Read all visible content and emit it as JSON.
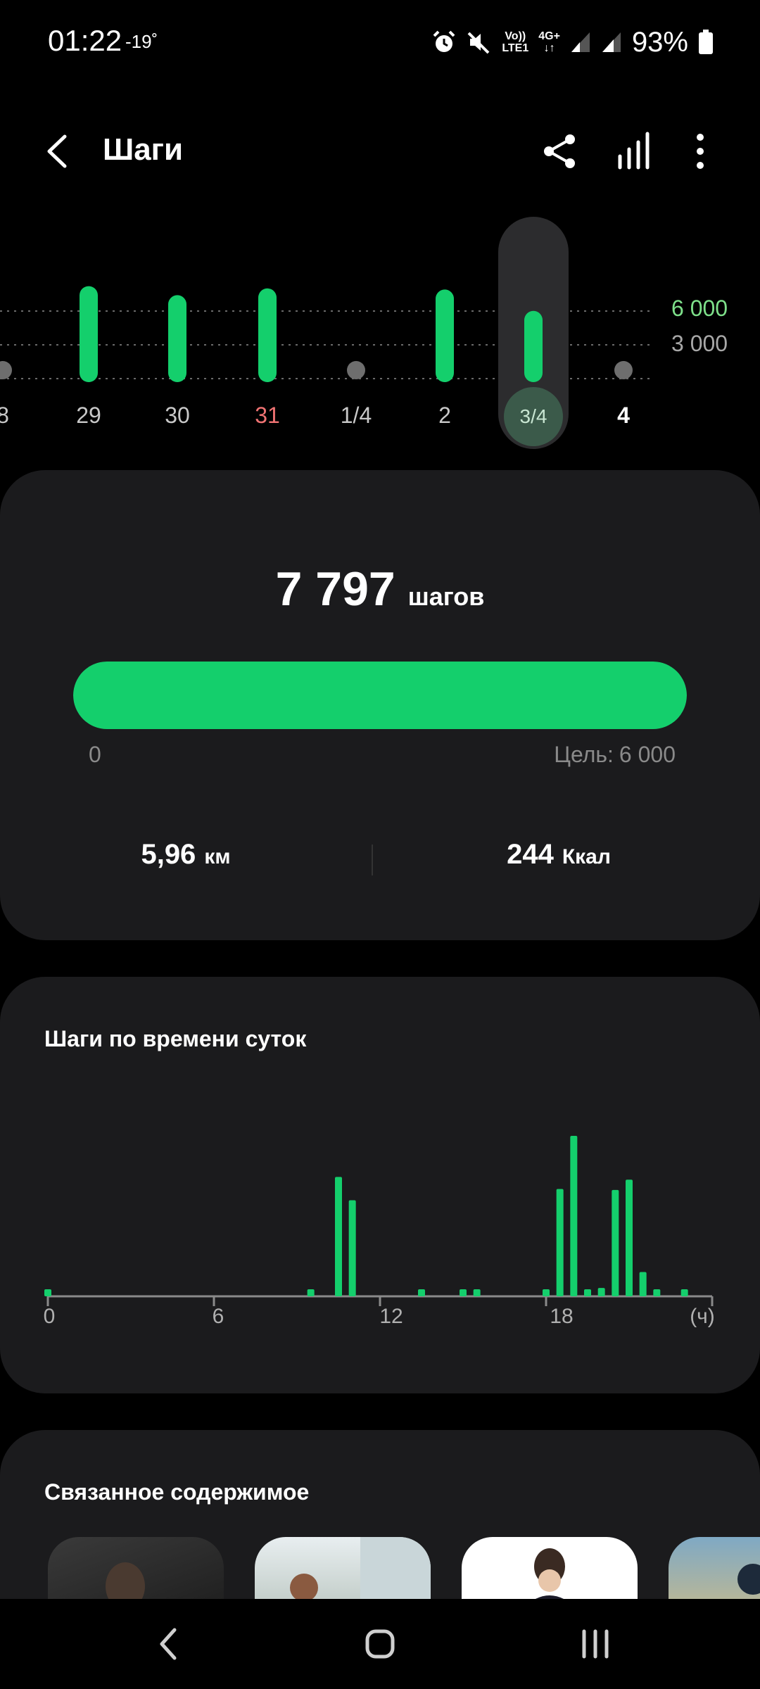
{
  "status_bar": {
    "time": "01:22",
    "temperature": "-19˚",
    "volte_line1": "Vo))",
    "volte_line2": "LTE1",
    "network_line1": "4G+",
    "network_line2": "↓↑",
    "battery": "93%",
    "icons": [
      "alarm-icon",
      "mute-icon",
      "signal-icon",
      "signal-icon",
      "battery-icon"
    ]
  },
  "header": {
    "title": "Шаги",
    "icons": [
      "back-arrow-icon",
      "share-icon",
      "bar-chart-icon",
      "more-vertical-icon"
    ]
  },
  "day_chart": {
    "type": "bar",
    "categories": [
      "8",
      "29",
      "30",
      "31",
      "1/4",
      "2",
      "3/4",
      "4"
    ],
    "values": [
      0,
      7400,
      6600,
      7200,
      0,
      7100,
      5200,
      0
    ],
    "reference_lines": [
      6000,
      3000
    ],
    "reference_labels": [
      "6 000",
      "3 000"
    ],
    "selected_category": "3/4",
    "holiday_category": "31",
    "today_category": "4",
    "colors": {
      "bar": "#14cf6c",
      "empty": "#6e6e6e",
      "goal_label": "#7ee08a"
    }
  },
  "summary": {
    "steps": "7 797",
    "steps_unit": "шагов",
    "progress_fraction": 1.0,
    "progress_min": "0",
    "goal_label": "Цель:",
    "goal_value": "6 000",
    "distance": "5,96",
    "distance_unit": "км",
    "calories": "244",
    "calories_unit": "Ккал"
  },
  "hourly": {
    "title": "Шаги по времени суток",
    "x_tick_labels": [
      "0",
      "6",
      "12",
      "18",
      "(ч)"
    ],
    "color": "#14cf6c"
  },
  "chart_data": {
    "type": "bar",
    "title": "Шаги по времени суток",
    "xlabel": "(ч)",
    "xlim": [
      0,
      24
    ],
    "x": [
      0,
      9.5,
      10.5,
      11,
      13.5,
      15,
      15.5,
      18,
      18.5,
      19,
      19.5,
      20,
      20.5,
      21,
      21.5,
      22,
      23
    ],
    "values": [
      60,
      60,
      1280,
      1030,
      50,
      60,
      60,
      60,
      1150,
      1720,
      60,
      90,
      1140,
      1250,
      260,
      50,
      60
    ]
  },
  "related": {
    "title": "Связанное содержимое"
  },
  "nav_bar": {
    "icons": [
      "recent-apps-icon",
      "home-icon",
      "nav-back-icon"
    ]
  }
}
